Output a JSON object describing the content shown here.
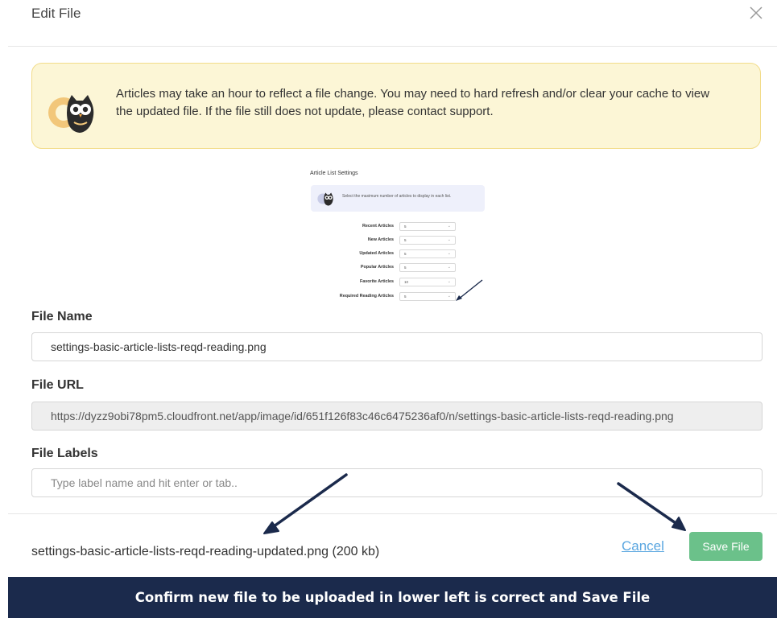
{
  "modal": {
    "title": "Edit File",
    "alert_text": "Articles may take an hour to reflect a file change. You may need to hard refresh and/or clear your cache to view the updated file. If the file still does not update, please contact support.",
    "icon_close": "close-icon",
    "icon_owl": "owl-icon"
  },
  "preview": {
    "title": "Article List Settings",
    "info_text": "Select the maximum number of articles to display in each list.",
    "rows": [
      {
        "label": "Recent Articles",
        "value": "5"
      },
      {
        "label": "New Articles",
        "value": "5"
      },
      {
        "label": "Updated Articles",
        "value": "5"
      },
      {
        "label": "Popular Articles",
        "value": "5"
      },
      {
        "label": "Favorite Articles",
        "value": "10"
      },
      {
        "label": "Required Reading Articles",
        "value": "5"
      }
    ]
  },
  "form": {
    "file_name_label": "File Name",
    "file_name_value": "settings-basic-article-lists-reqd-reading.png",
    "file_url_label": "File URL",
    "file_url_value": "https://dyzz9obi78pm5.cloudfront.net/app/image/id/651f126f83c46c6475236af0/n/settings-basic-article-lists-reqd-reading.png",
    "file_labels_label": "File Labels",
    "file_labels_placeholder": "Type label name and hit enter or tab.."
  },
  "footer": {
    "upload_name": "settings-basic-article-lists-reqd-reading-updated.png (200 kb)",
    "cancel_label": "Cancel",
    "save_label": "Save File"
  },
  "banner": {
    "text": "Confirm new file to be uploaded in lower left is correct and Save File"
  },
  "colors": {
    "alert_bg": "#fcf6d6",
    "save_button": "#6bc18a",
    "cancel_link": "#5aa6e0",
    "banner_bg": "#1b2a4c",
    "arrow": "#1b2a4c"
  }
}
